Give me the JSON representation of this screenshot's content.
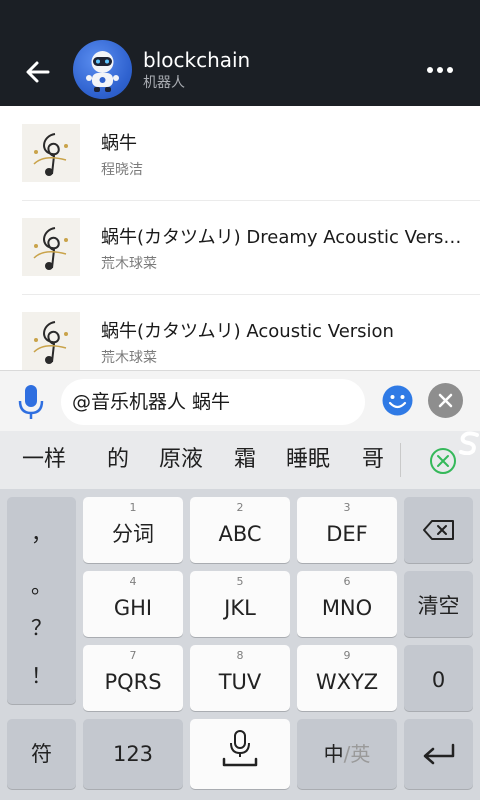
{
  "header": {
    "title": "blockchain",
    "subtitle": "机器人",
    "back_icon": "arrow-left-icon",
    "more_icon": "more-horizontal-icon",
    "background": "#1b1f25"
  },
  "songs": [
    {
      "title": "蜗牛",
      "artist": "程晓洁"
    },
    {
      "title": "蜗牛(カタツムリ) Dreamy Acoustic Vers…",
      "artist": "荒木球菜"
    },
    {
      "title": "蜗牛(カタツムリ) Acoustic Version",
      "artist": "荒木球菜"
    }
  ],
  "input": {
    "value": "@音乐机器人 蜗牛",
    "mic_icon": "microphone-icon",
    "emoji_icon": "smiley-icon",
    "clear_icon": "clear-icon",
    "accent": "#2f6fe0"
  },
  "candidates": [
    "一样",
    "的",
    "原液",
    "霜",
    "睡眠",
    "哥"
  ],
  "keyboard": {
    "punctuation": [
      "，",
      "。",
      "？",
      "！"
    ],
    "keys": [
      {
        "num": "1",
        "label": "分词"
      },
      {
        "num": "2",
        "label": "ABC"
      },
      {
        "num": "3",
        "label": "DEF"
      },
      {
        "num": "4",
        "label": "GHI"
      },
      {
        "num": "5",
        "label": "JKL"
      },
      {
        "num": "6",
        "label": "MNO"
      },
      {
        "num": "7",
        "label": "PQRS"
      },
      {
        "num": "8",
        "label": "TUV"
      },
      {
        "num": "9",
        "label": "WXYZ"
      }
    ],
    "clear_label": "清空",
    "zero_label": "0",
    "symbol_label": "符",
    "num_label": "123",
    "lang_zh": "中",
    "lang_sep": "/",
    "lang_en": "英"
  }
}
